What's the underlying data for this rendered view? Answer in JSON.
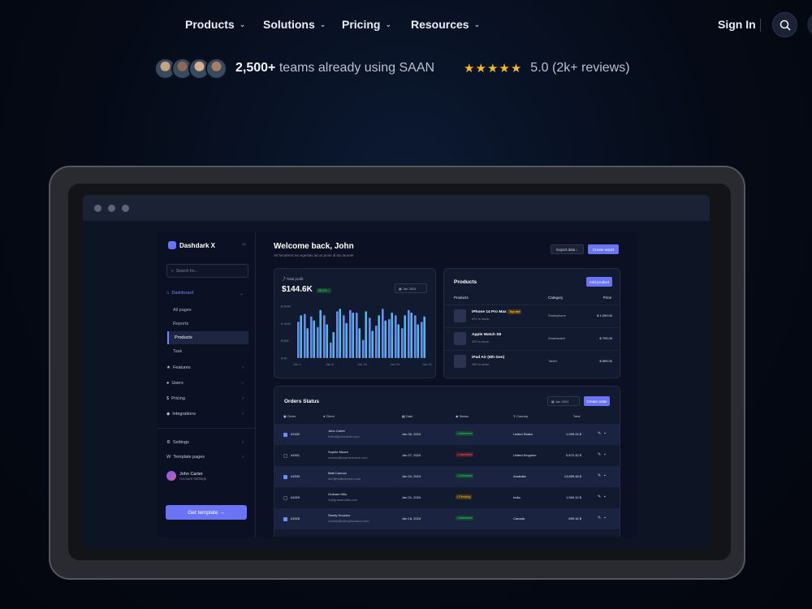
{
  "nav": {
    "items": [
      {
        "label": "Products"
      },
      {
        "label": "Solutions"
      },
      {
        "label": "Pricing"
      },
      {
        "label": "Resources"
      }
    ],
    "sign_in": "Sign In"
  },
  "social_proof": {
    "teams_count": "2,500+",
    "teams_text": "teams already using SAAN",
    "stars": "★★★★★",
    "rating": "5.0 (2k+ reviews)",
    "avatar_colors": [
      "#c9a27f",
      "#8a6a55",
      "#d9b08c",
      "#a77e63"
    ]
  },
  "dashboard": {
    "brand": "Dashdark X",
    "search_placeholder": "Search for...",
    "sidebar": {
      "dashboard": "Dashboard",
      "sub_items": [
        "All pages",
        "Reports",
        "Products",
        "Task"
      ],
      "features": "Features",
      "users": "Users",
      "pricing": "Pricing",
      "integrations": "Integrations",
      "settings": "Settings",
      "template_pages": "Template pages",
      "user_name": "John Carter",
      "user_sub": "Account settings",
      "get_template": "Get template →"
    },
    "header": {
      "title": "Welcome back, John",
      "subtitle": "Sit hendrerit leo egestas lacus proin id lao laoreet",
      "export": "Export data ↓",
      "create_report": "Create report"
    },
    "profit": {
      "label": "Total profit",
      "value": "$144.6K",
      "change": "28.5% ↑",
      "date": "Jan 2024"
    },
    "products": {
      "title": "Products",
      "add": "Add product",
      "columns": [
        "Products",
        "Category",
        "Price"
      ],
      "rows": [
        {
          "name": "iPhone 14 Pro Max",
          "badge": "Top bid",
          "stock": "524 in stock",
          "category": "Smartphone",
          "price": "$ 1,099.00"
        },
        {
          "name": "Apple Watch S8",
          "stock": "320 in stock",
          "category": "Smartwatch",
          "price": "$ 799.00"
        },
        {
          "name": "iPad Air (5th Gen)",
          "stock": "480 in stock",
          "category": "Tablet",
          "price": "$ 899.00"
        }
      ]
    },
    "orders": {
      "title": "Orders Status",
      "date": "Jan 2024",
      "create": "Create order",
      "columns": [
        "Order",
        "Client",
        "Date",
        "Status",
        "Country",
        "Total"
      ],
      "rows": [
        {
          "id": "#1532",
          "client": "John Carter",
          "email": "hello@johncarter.com",
          "date": "Jan 30, 2024",
          "status": "Delivered",
          "country": "United States",
          "total": "$ 1,099.24",
          "checked": true
        },
        {
          "id": "#1531",
          "client": "Sophie Moore",
          "email": "contact@sophiemoore.com",
          "date": "Jan 27, 2024",
          "status": "Canceled",
          "country": "United Kingdom",
          "total": "$ 5,870.32",
          "checked": false
        },
        {
          "id": "#1530",
          "client": "Matt Cannon",
          "email": "info@mattcannon.com",
          "date": "Jan 24, 2024",
          "status": "Delivered",
          "country": "Australia",
          "total": "$ 13,899.48",
          "checked": true
        },
        {
          "id": "#1529",
          "client": "Graham Hills",
          "email": "hi@grahamhills.com",
          "date": "Jan 21, 2024",
          "status": "Pending",
          "country": "India",
          "total": "$ 1,569.12",
          "checked": false
        },
        {
          "id": "#1528",
          "client": "Sandy Houston",
          "email": "contact@sandyhouston.com",
          "date": "Jan 18, 2024",
          "status": "Delivered",
          "country": "Canada",
          "total": "$ 899.16",
          "checked": true
        }
      ]
    }
  },
  "chart_data": {
    "type": "bar",
    "x_tick_labels": [
      "Jan 1",
      "Jan 8",
      "Jan 16",
      "Jan 24",
      "Jan 31"
    ],
    "y_tick_labels": [
      "$ 200K",
      "$ 100K",
      "$ 50K",
      "$ 0K"
    ],
    "series": [
      {
        "values": [
          140,
          170,
          160,
          120,
          165,
          60,
          180,
          165,
          185,
          175,
          70,
          155,
          125,
          190,
          150,
          165,
          115,
          185,
          165,
          140
        ],
        "color": "#6a8cf0"
      },
      {
        "values": [
          165,
          115,
          145,
          185,
          130,
          100,
          190,
          135,
          175,
          115,
          180,
          105,
          165,
          145,
          175,
          130,
          165,
          175,
          130,
          160
        ],
        "color": "#4fb7ea"
      }
    ],
    "ylim": [
      0,
      200
    ]
  }
}
